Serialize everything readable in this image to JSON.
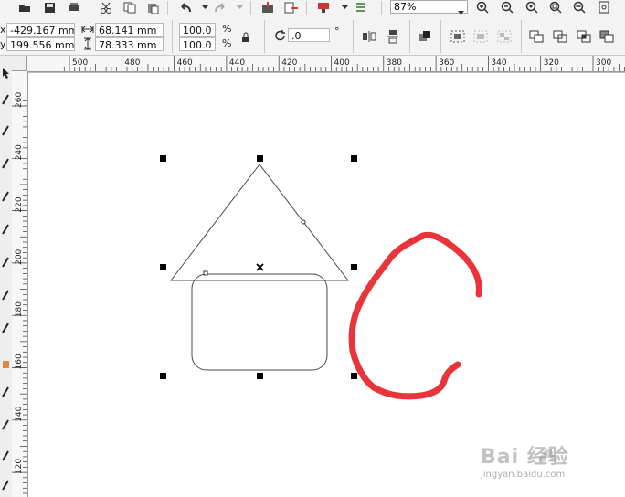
{
  "toolbar": {
    "zoom_value": "87%",
    "position": {
      "x": "-429.167 mm",
      "y": "199.556 mm"
    },
    "size": {
      "width": "68.141 mm",
      "height": "78.333 mm"
    },
    "scale": {
      "x": "100.0",
      "y": "100.0",
      "unit": "%"
    },
    "rotation": {
      "value": ".0",
      "unit": "°"
    }
  },
  "rulers": {
    "horizontal_ticks": [
      "500",
      "480",
      "460",
      "440",
      "420",
      "400",
      "380",
      "360",
      "340",
      "320",
      "300"
    ],
    "vertical_ticks": [
      "260",
      "240",
      "220",
      "200",
      "180",
      "160",
      "140",
      "120"
    ]
  },
  "watermark": {
    "brand": "Bai 经验",
    "url": "jingyan.baidu.com"
  },
  "colors": {
    "stroke_red": "#e8343a",
    "object_outline": "#4a4a4a",
    "handle": "#000000"
  },
  "icons": [
    "open-icon",
    "save-icon",
    "print-icon",
    "cut-icon",
    "copy-icon",
    "paste-icon",
    "undo-icon",
    "redo-icon",
    "import-icon",
    "export-icon",
    "publish-icon",
    "options-icon",
    "zoom-in-icon",
    "zoom-out-icon",
    "zoom-fit-icon",
    "zoom-page-icon",
    "zoom-width-icon",
    "lock-ratio-icon",
    "mirror-h-icon",
    "mirror-v-icon",
    "to-front-icon",
    "group-icon",
    "ungroup-icon",
    "ungroup-all-icon",
    "weld-icon",
    "trim-icon",
    "intersect-icon",
    "simplify-icon"
  ]
}
